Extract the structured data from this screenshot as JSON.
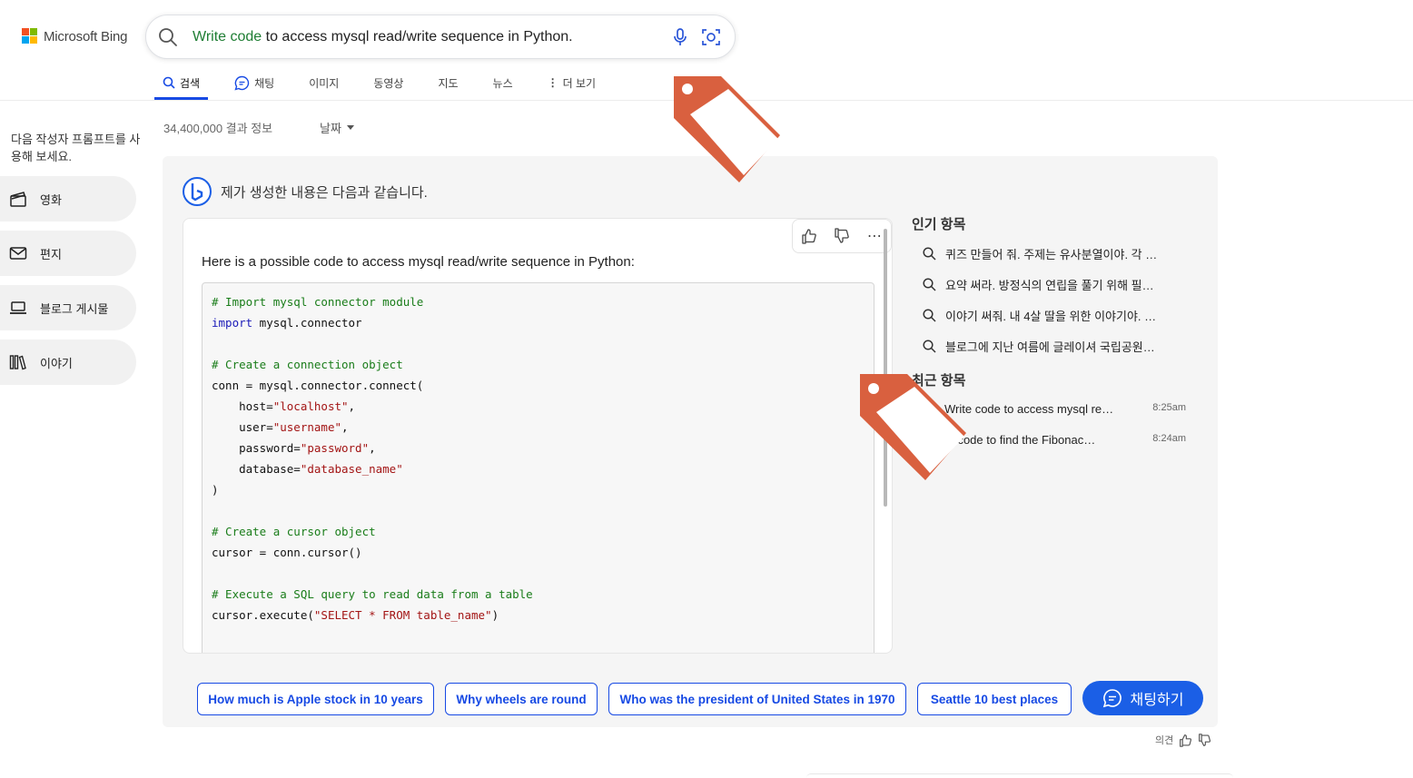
{
  "header": {
    "logo_text": "Microsoft Bing",
    "query_highlight": "Write code",
    "query_rest": " to access mysql read/write sequence in Python.",
    "tabs": [
      "검색",
      "채팅",
      "이미지",
      "동영상",
      "지도",
      "뉴스",
      "더 보기"
    ]
  },
  "results": {
    "count": "34,400,000 결과 정보",
    "date_filter": "날짜"
  },
  "sidebar": {
    "prompt": "다음 작성자 프롬프트를 사용해 보세요.",
    "items": [
      "영화",
      "편지",
      "블로그 게시물",
      "이야기"
    ]
  },
  "chat": {
    "generated_label": "제가 생성한 내용은 다음과 같습니다.",
    "answer_intro": "Here is a possible code to access mysql read/write sequence in Python:",
    "code": {
      "l1": "# Import mysql connector module",
      "l2kw": "import",
      "l2": " mysql.connector",
      "l3": "# Create a connection object",
      "l4": "conn = mysql.connector.connect(",
      "l5a": "    host=",
      "l5b": "\"localhost\"",
      "l5c": ",",
      "l6a": "    user=",
      "l6b": "\"username\"",
      "l6c": ",",
      "l7a": "    password=",
      "l7b": "\"password\"",
      "l7c": ",",
      "l8a": "    database=",
      "l8b": "\"database_name\"",
      "l9": ")",
      "l10": "# Create a cursor object",
      "l11": "cursor = conn.cursor()",
      "l12": "# Execute a SQL query to read data from a table",
      "l13a": "cursor.execute(",
      "l13b": "\"SELECT * FROM table_name\"",
      "l13c": ")"
    },
    "suggestions": [
      "How much is Apple stock in 10 years",
      "Why wheels are round",
      "Who was the president of United States in 1970",
      "Seattle 10 best places"
    ],
    "chat_button": "채팅하기"
  },
  "right": {
    "popular_title": "인기 항목",
    "popular": [
      "퀴즈 만들어 줘. 주제는 유사분열이야. 각 …",
      "요약 써라. 방정식의 연립을 풀기 위해 필…",
      "이야기 써줘. 내 4살 딸을 위한 이야기야. …",
      "블로그에 지난 여름에 글레이셔 국립공원…"
    ],
    "recent_title": "최근 항목",
    "recent": [
      {
        "text": "Write code to access mysql re…",
        "time": "8:25am"
      },
      {
        "text": "te code to find the Fibonac…",
        "time": "8:24am"
      }
    ]
  },
  "feedback": {
    "label": "의견"
  },
  "colors": {
    "accent": "#174ae4",
    "chat_button": "#1b5fe6",
    "tag": "#d9603f",
    "highlight": "#1e7d33"
  }
}
